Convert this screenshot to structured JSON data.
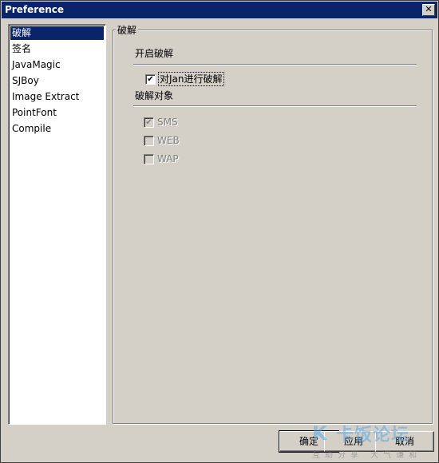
{
  "window": {
    "title": "Preference",
    "close_glyph": "✕"
  },
  "tree": {
    "items": [
      {
        "label": "破解",
        "selected": true
      },
      {
        "label": "签名"
      },
      {
        "label": "JavaMagic"
      },
      {
        "label": "SJBoy"
      },
      {
        "label": "Image Extract"
      },
      {
        "label": "PointFont"
      },
      {
        "label": "Compile"
      }
    ]
  },
  "panel": {
    "title": "破解",
    "enable_section": "开启破解",
    "enable_checkbox": {
      "label": "对Jan进行破解",
      "checked": true,
      "mark": "✔"
    },
    "target_section": "破解对象",
    "targets": [
      {
        "label": "SMS",
        "checked": true,
        "disabled": true,
        "mark": "✔"
      },
      {
        "label": "WEB",
        "checked": false,
        "disabled": true,
        "mark": ""
      },
      {
        "label": "WAP",
        "checked": false,
        "disabled": true,
        "mark": ""
      }
    ]
  },
  "buttons": {
    "ok": "确定",
    "apply": "应用",
    "cancel": "取消"
  },
  "watermark": {
    "logo": "K",
    "text": "卡饭论坛",
    "subtitle": "互助分享 大气谦和"
  }
}
